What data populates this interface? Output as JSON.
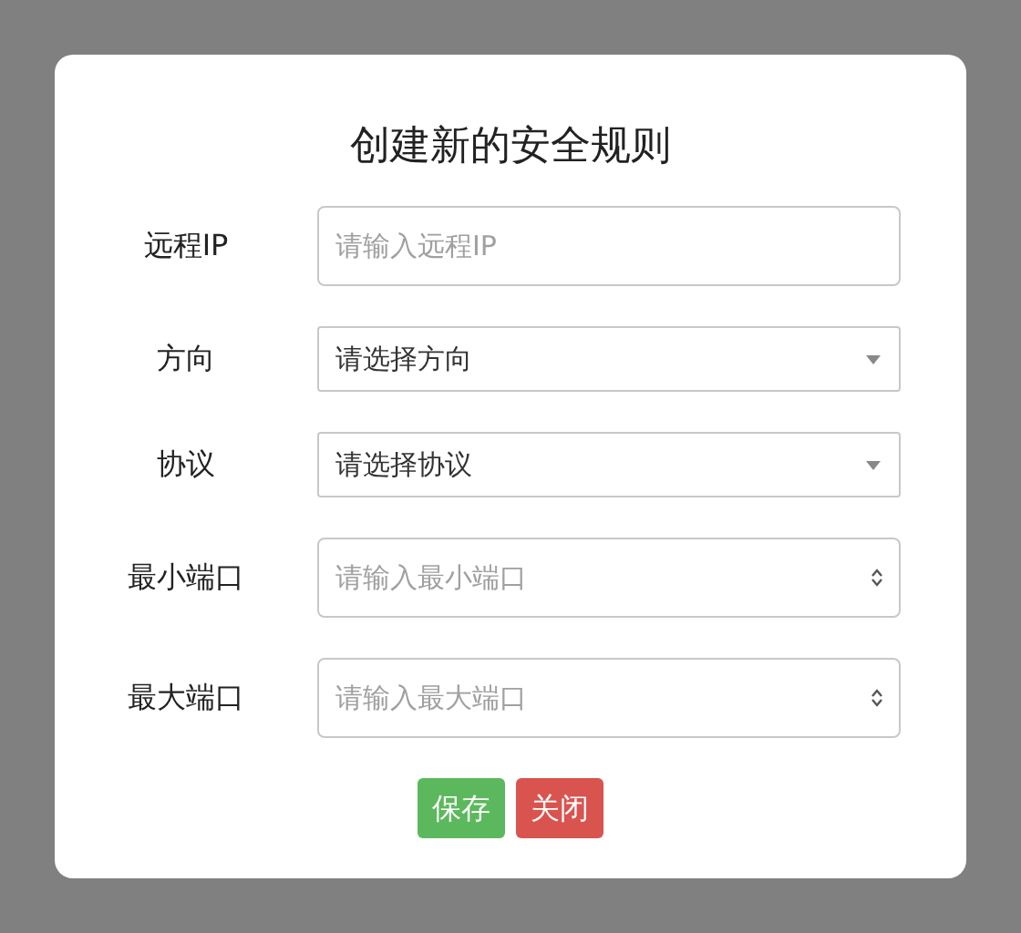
{
  "dialog": {
    "title": "创建新的安全规则",
    "fields": [
      {
        "label": "远程IP",
        "kind": "text",
        "placeholder": "请输入远程IP"
      },
      {
        "label": "方向",
        "kind": "select",
        "value": "请选择方向"
      },
      {
        "label": "协议",
        "kind": "select",
        "value": "请选择协议"
      },
      {
        "label": "最小端口",
        "kind": "number",
        "placeholder": "请输入最小端口"
      },
      {
        "label": "最大端口",
        "kind": "number",
        "placeholder": "请输入最大端口"
      }
    ],
    "buttons": [
      {
        "label": "保存",
        "kind": "primary"
      },
      {
        "label": "关闭",
        "kind": "danger"
      }
    ]
  }
}
